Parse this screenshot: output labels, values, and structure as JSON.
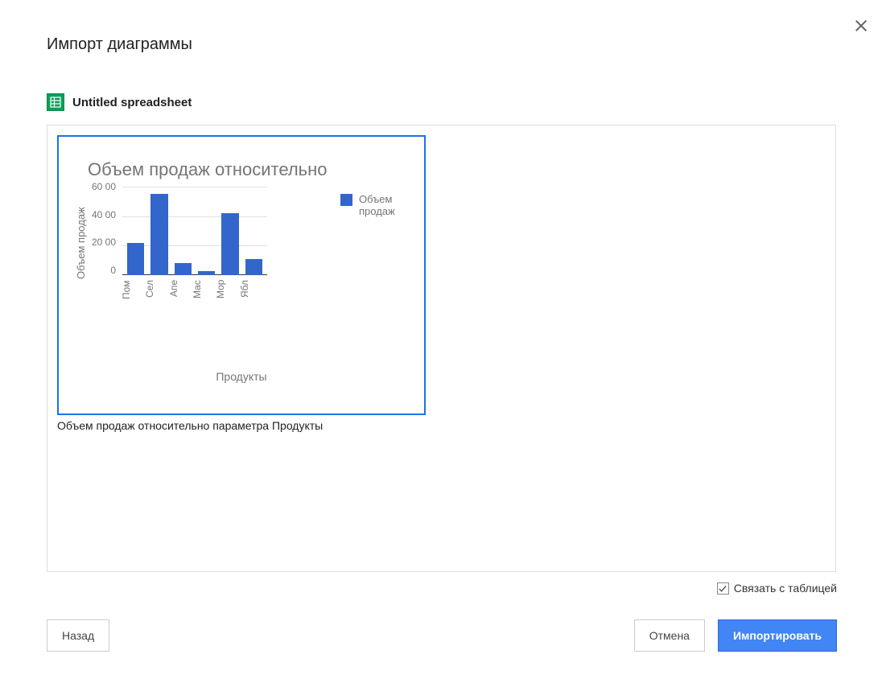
{
  "dialog": {
    "title": "Импорт диаграммы",
    "file_name": "Untitled spreadsheet",
    "chart_caption": "Объем продаж относительно параметра Продукты",
    "link_label": "Связать с таблицей",
    "link_checked": true,
    "back_label": "Назад",
    "cancel_label": "Отмена",
    "import_label": "Импортировать"
  },
  "chart_data": {
    "type": "bar",
    "title": "Объем продаж относительно",
    "xlabel": "Продукты",
    "ylabel": "Объем продаж",
    "categories": [
      "Пом",
      "Сел",
      "Апе",
      "Мас",
      "Мор",
      "Ябл"
    ],
    "values": [
      2200,
      5500,
      800,
      300,
      4200,
      1100
    ],
    "ylim": [
      0,
      6000
    ],
    "y_ticks": [
      "60 00",
      "40 00",
      "20 00",
      "0"
    ],
    "legend": "Объем продаж",
    "colors": {
      "bar": "#3366cc"
    }
  }
}
